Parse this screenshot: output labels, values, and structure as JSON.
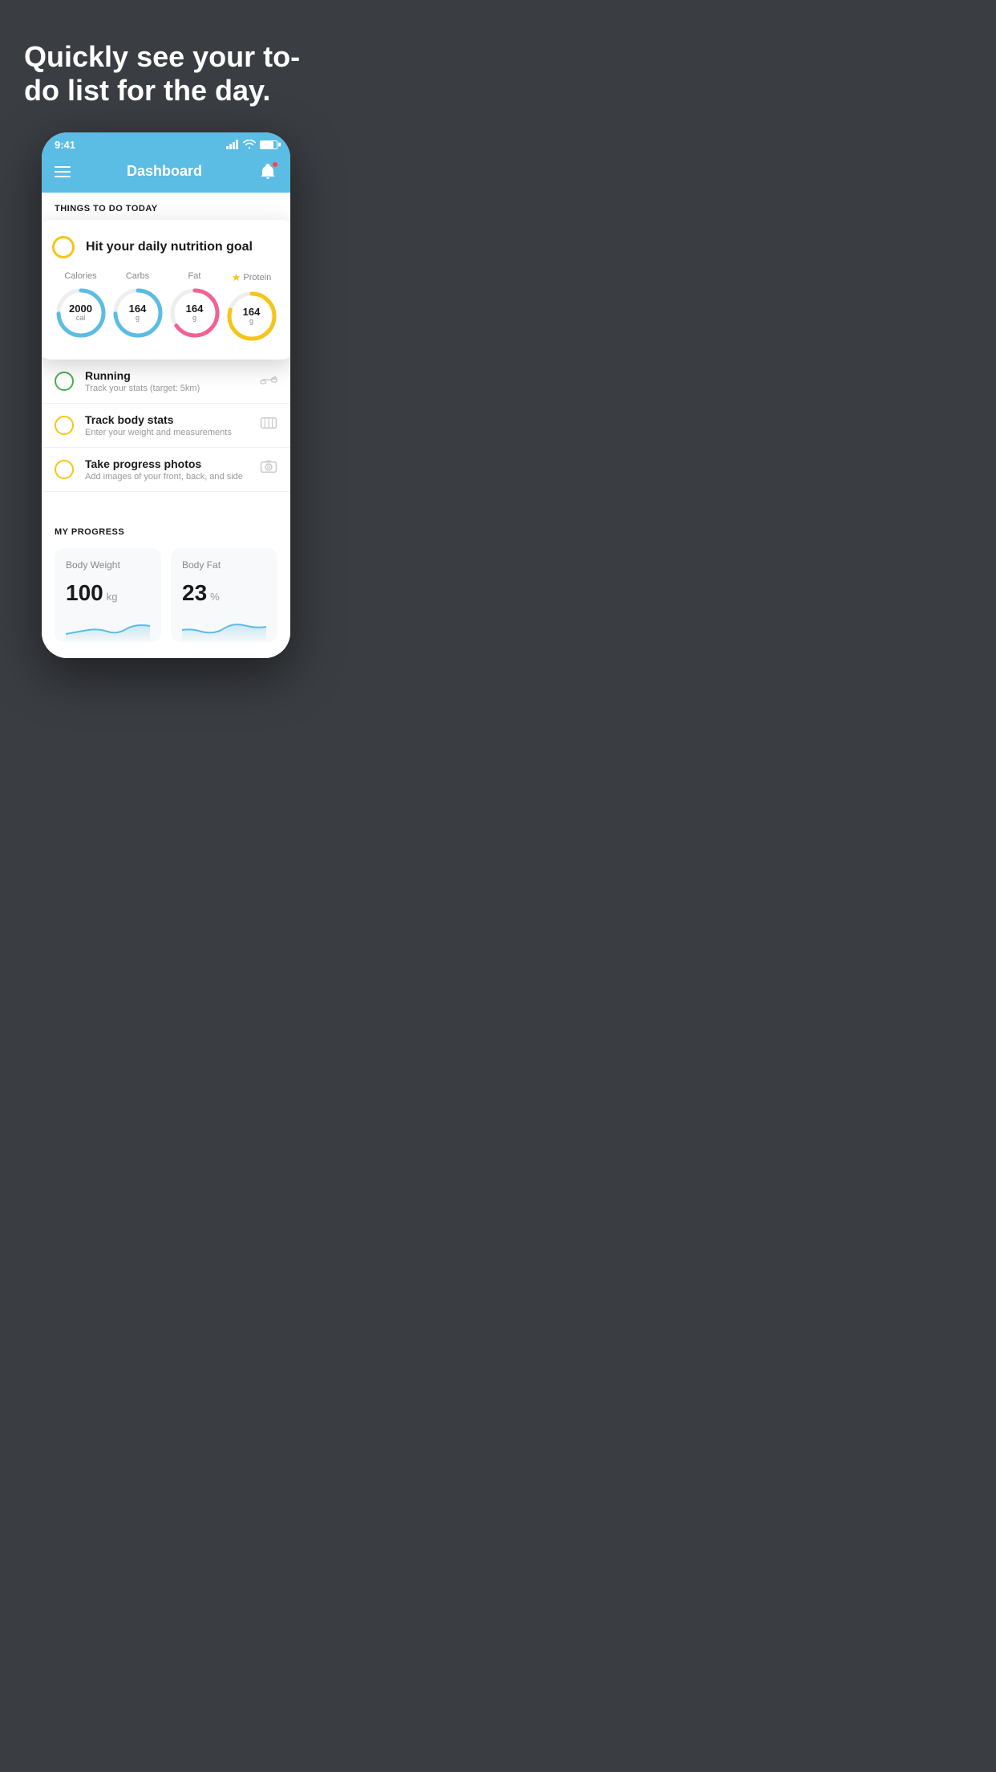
{
  "hero": {
    "title": "Quickly see your to-do list for the day."
  },
  "phone": {
    "statusBar": {
      "time": "9:41",
      "signal": "▂▄▆█",
      "wifi": "wifi",
      "battery": "battery"
    },
    "header": {
      "title": "Dashboard",
      "menuLabel": "menu",
      "notificationLabel": "notifications"
    },
    "sectionHeader": "THINGS TO DO TODAY",
    "nutritionCard": {
      "checkColor": "#f5c518",
      "title": "Hit your daily nutrition goal",
      "nutrients": [
        {
          "label": "Calories",
          "value": "2000",
          "unit": "cal",
          "color": "#5bbce4",
          "starred": false
        },
        {
          "label": "Carbs",
          "value": "164",
          "unit": "g",
          "color": "#5bbce4",
          "starred": false
        },
        {
          "label": "Fat",
          "value": "164",
          "unit": "g",
          "color": "#f06292",
          "starred": false
        },
        {
          "label": "Protein",
          "value": "164",
          "unit": "g",
          "color": "#f5c518",
          "starred": true
        }
      ]
    },
    "todoItems": [
      {
        "checkColor": "green",
        "title": "Running",
        "subtitle": "Track your stats (target: 5km)",
        "icon": "shoe"
      },
      {
        "checkColor": "yellow",
        "title": "Track body stats",
        "subtitle": "Enter your weight and measurements",
        "icon": "scale"
      },
      {
        "checkColor": "yellow",
        "title": "Take progress photos",
        "subtitle": "Add images of your front, back, and side",
        "icon": "photo"
      }
    ],
    "progressSection": {
      "title": "MY PROGRESS",
      "cards": [
        {
          "title": "Body Weight",
          "value": "100",
          "unit": "kg"
        },
        {
          "title": "Body Fat",
          "value": "23",
          "unit": "%"
        }
      ]
    }
  }
}
